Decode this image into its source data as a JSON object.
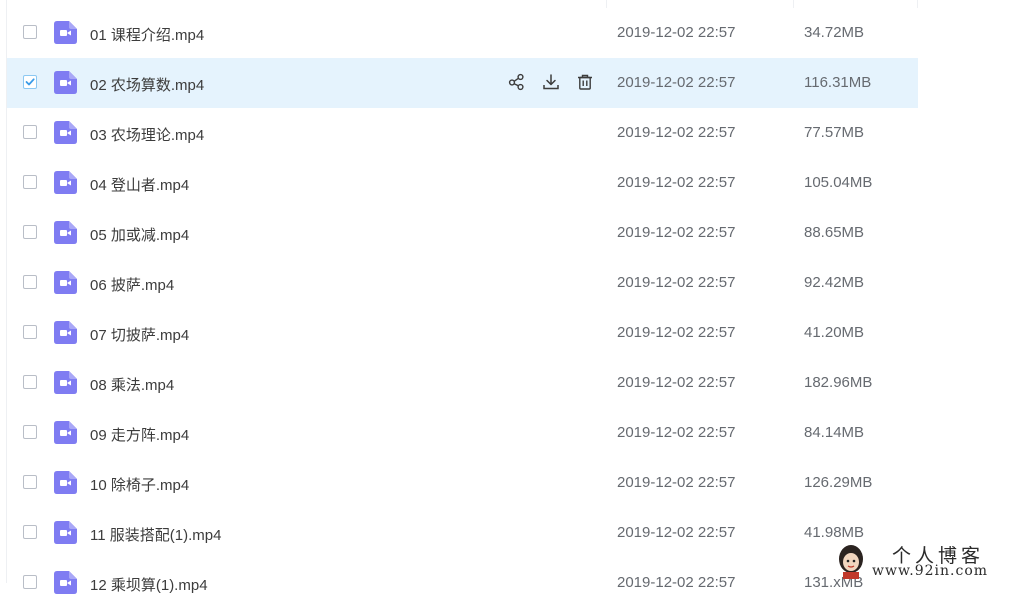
{
  "files": [
    {
      "name": "01 课程介绍.mp4",
      "date": "2019-12-02 22:57",
      "size": "34.72MB",
      "selected": false
    },
    {
      "name": "02 农场算数.mp4",
      "date": "2019-12-02 22:57",
      "size": "116.31MB",
      "selected": true
    },
    {
      "name": "03 农场理论.mp4",
      "date": "2019-12-02 22:57",
      "size": "77.57MB",
      "selected": false
    },
    {
      "name": "04 登山者.mp4",
      "date": "2019-12-02 22:57",
      "size": "105.04MB",
      "selected": false
    },
    {
      "name": "05 加或减.mp4",
      "date": "2019-12-02 22:57",
      "size": "88.65MB",
      "selected": false
    },
    {
      "name": "06 披萨.mp4",
      "date": "2019-12-02 22:57",
      "size": "92.42MB",
      "selected": false
    },
    {
      "name": "07 切披萨.mp4",
      "date": "2019-12-02 22:57",
      "size": "41.20MB",
      "selected": false
    },
    {
      "name": "08 乘法.mp4",
      "date": "2019-12-02 22:57",
      "size": "182.96MB",
      "selected": false
    },
    {
      "name": "09 走方阵.mp4",
      "date": "2019-12-02 22:57",
      "size": "84.14MB",
      "selected": false
    },
    {
      "name": "10 除椅子.mp4",
      "date": "2019-12-02 22:57",
      "size": "126.29MB",
      "selected": false
    },
    {
      "name": "11 服装搭配(1).mp4",
      "date": "2019-12-02 22:57",
      "size": "41.98MB",
      "selected": false
    },
    {
      "name": "12 乘坝算(1).mp4",
      "date": "2019-12-02 22:57",
      "size": "131.xMB",
      "selected": false
    }
  ],
  "row_actions": {
    "share_icon": "share-icon",
    "download_icon": "download-icon",
    "delete_icon": "trash-icon"
  },
  "watermark": {
    "name": "个人博客",
    "url": "www.92in.com"
  },
  "colors": {
    "selected_row": "#e5f3fd",
    "file_icon": "#7f7cf2",
    "checkbox_check": "#3a9be8"
  }
}
